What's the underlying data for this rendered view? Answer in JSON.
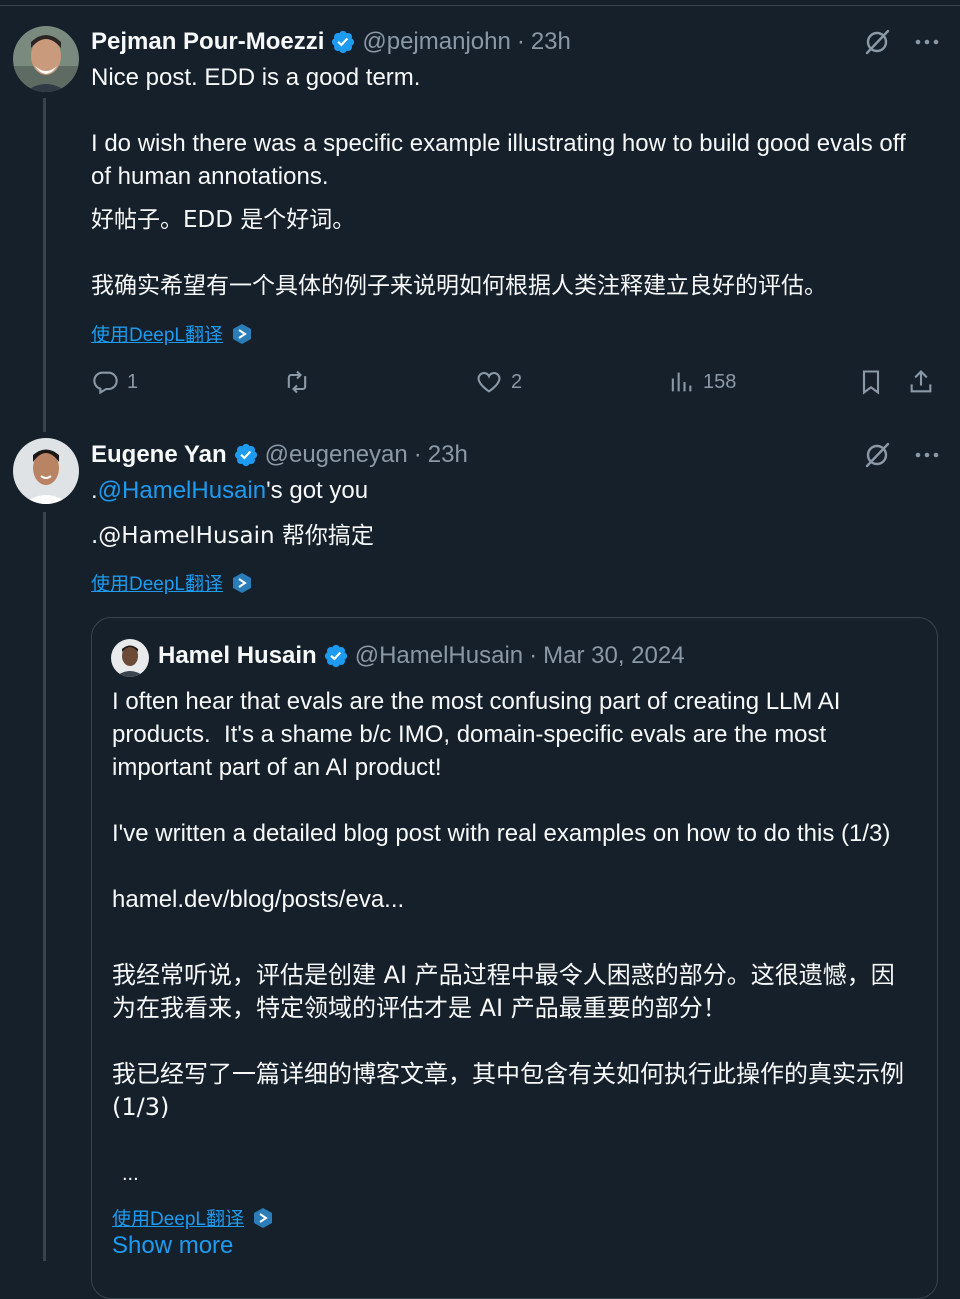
{
  "tweet1": {
    "name": "Pejman Pour-Moezzi",
    "handle": "@pejmanjohn",
    "separator": "·",
    "time": "23h",
    "text_en": "Nice post. EDD is a good term.\n\nI do wish there was a specific example illustrating how to build good evals off of human annotations.",
    "text_zh": "好帖子。EDD 是个好词。\n\n我确实希望有一个具体的例子来说明如何根据人类注释建立良好的评估。",
    "translate_label": "使用DeepL翻译",
    "actions": {
      "reply_count": "1",
      "retweet_count": "",
      "like_count": "2",
      "view_count": "158"
    }
  },
  "tweet2": {
    "name": "Eugene Yan",
    "handle": "@eugeneyan",
    "separator": "·",
    "time": "23h",
    "text_prefix": ".",
    "mention": "@HamelHusain",
    "text_suffix": "'s got you",
    "text_zh": ".@HamelHusain 帮你搞定",
    "translate_label": "使用DeepL翻译"
  },
  "quote": {
    "name": "Hamel Husain",
    "handle": "@HamelHusain",
    "separator": "·",
    "time": "Mar 30, 2024",
    "text_en": "I often hear that evals are the most confusing part of creating LLM AI products.  It's a shame b/c IMO, domain-specific evals are the most important part of an AI product!\n\nI've written a detailed blog post with real examples on how to do this (1/3)\n\nhamel.dev/blog/posts/eva...",
    "text_zh": "我经常听说，评估是创建 AI 产品过程中最令人困惑的部分。这很遗憾，因为在我看来，特定领域的评估才是 AI 产品最重要的部分！\n\n我已经写了一篇详细的博客文章，其中包含有关如何执行此操作的真实示例 (1/3)",
    "ellipsis": "...",
    "translate_label": "使用DeepL翻译",
    "show_more": "Show more"
  },
  "colors": {
    "background": "#15202b",
    "accent": "#1d9bf0",
    "muted": "#8b98a5",
    "border": "#38444d"
  }
}
